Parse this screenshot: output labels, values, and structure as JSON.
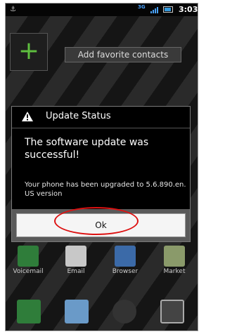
{
  "status_bar": {
    "network": "3G",
    "time": "3:03",
    "icons": [
      "usb-icon",
      "signal-icon",
      "battery-icon"
    ]
  },
  "home": {
    "add_tile_symbol": "+",
    "favorite_label": "Add favorite contacts"
  },
  "dialog": {
    "title": "Update Status",
    "icon": "warning-icon",
    "message": "The software update was successful!",
    "details": "Your phone has been upgraded to 5.6.890.en. US version",
    "ok_label": "Ok"
  },
  "apps": [
    {
      "label": "Voicemail",
      "icon": "voicemail-icon",
      "color": "#2f7d3a"
    },
    {
      "label": "Email",
      "icon": "email-icon",
      "color": "#c8c8c8"
    },
    {
      "label": "Browser",
      "icon": "browser-icon",
      "color": "#3b6aa8"
    },
    {
      "label": "Market",
      "icon": "market-icon",
      "color": "#8a9a6a"
    }
  ],
  "dock": [
    {
      "icon": "phone-icon",
      "color": "#2f7d3a"
    },
    {
      "icon": "messages-icon",
      "color": "#6a9ac8"
    },
    {
      "icon": "camera-icon",
      "color": "#333333"
    },
    {
      "icon": "launcher-icon",
      "color": "#444444"
    }
  ]
}
